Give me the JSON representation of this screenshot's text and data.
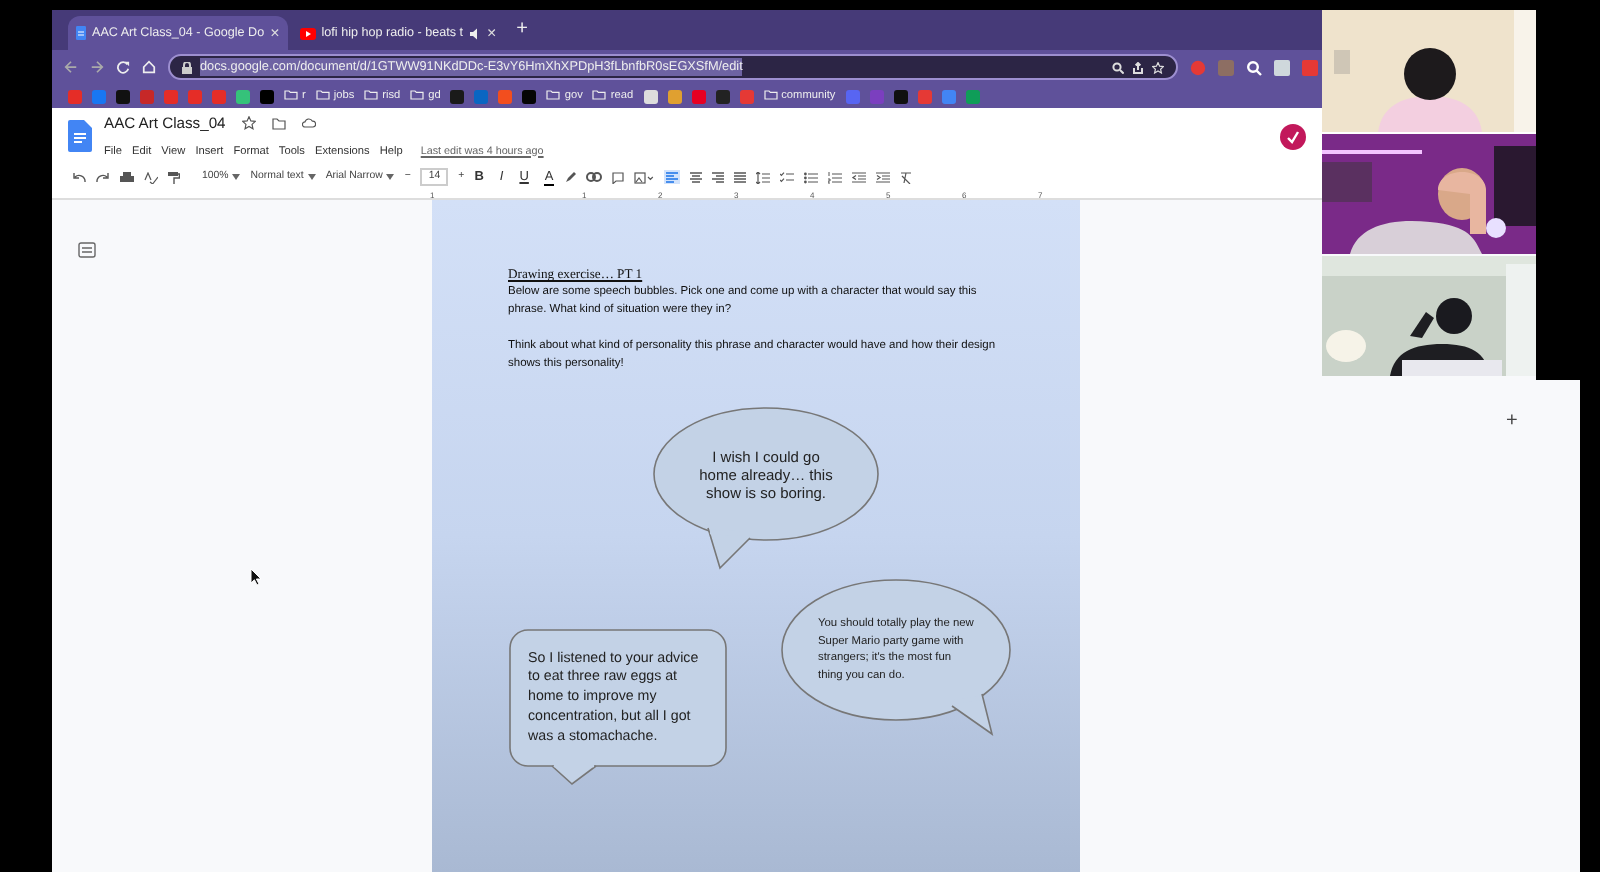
{
  "browser": {
    "tabs": [
      {
        "title": "AAC Art Class_04 - Google Do",
        "selected": true,
        "close": "×"
      },
      {
        "title": "lofi hip hop radio - beats t",
        "selected": false,
        "close": "×",
        "audio": true
      }
    ],
    "new_tab": "+",
    "url": "docs.google.com/document/d/1GTWW91NKdDDc-E3vY6HmXhXPDpH3fLbnfbR0sEGXSfM/edit",
    "bookmarks": [
      {
        "kind": "site",
        "color": "#e52d27"
      },
      {
        "kind": "site",
        "color": "#1877f2"
      },
      {
        "kind": "site",
        "color": "#111111"
      },
      {
        "kind": "site",
        "color": "#c62828"
      },
      {
        "kind": "site",
        "color": "#e52d27"
      },
      {
        "kind": "site",
        "color": "#e52d27"
      },
      {
        "kind": "site",
        "color": "#e52d27"
      },
      {
        "kind": "site",
        "color": "#35c27a"
      },
      {
        "kind": "site",
        "color": "#000000"
      },
      {
        "kind": "folder",
        "label": "r"
      },
      {
        "kind": "folder",
        "label": "jobs"
      },
      {
        "kind": "folder",
        "label": "risd"
      },
      {
        "kind": "folder",
        "label": "gd"
      },
      {
        "kind": "site",
        "color": "#1a1a1a"
      },
      {
        "kind": "site",
        "color": "#0a66c2"
      },
      {
        "kind": "site",
        "color": "#f24e1e"
      },
      {
        "kind": "site",
        "color": "#050505"
      },
      {
        "kind": "folder",
        "label": "gov"
      },
      {
        "kind": "folder",
        "label": "read"
      },
      {
        "kind": "site",
        "color": "#dddddd"
      },
      {
        "kind": "site",
        "color": "#e0a030"
      },
      {
        "kind": "site",
        "color": "#e60023"
      },
      {
        "kind": "site",
        "color": "#222222"
      },
      {
        "kind": "site",
        "color": "#e53935"
      },
      {
        "kind": "folder",
        "label": "community"
      },
      {
        "kind": "site",
        "color": "#5865f2"
      },
      {
        "kind": "site",
        "color": "#7b3fbf"
      },
      {
        "kind": "site",
        "color": "#101010"
      },
      {
        "kind": "site",
        "color": "#e53935"
      },
      {
        "kind": "site",
        "color": "#4285f4"
      },
      {
        "kind": "site",
        "color": "#0f9d58"
      }
    ]
  },
  "docs": {
    "title": "AAC Art Class_04",
    "menu": [
      "File",
      "Edit",
      "View",
      "Insert",
      "Format",
      "Tools",
      "Extensions",
      "Help"
    ],
    "last_edit": "Last edit was 4 hours ago",
    "toolbar": {
      "zoom": "100%",
      "style": "Normal text",
      "font": "Arial Narrow",
      "size_minus": "−",
      "font_size": "14",
      "size_plus": "+",
      "format": [
        "B",
        "I",
        "U",
        "A"
      ]
    },
    "ruler": [
      "1",
      "1",
      "2",
      "3",
      "4",
      "5",
      "6",
      "7"
    ],
    "heading": "Drawing exercise… PT 1",
    "paragraphs": [
      "Below are some speech bubbles. Pick one and come up with a character that would say this phrase. What kind of situation were they in?",
      "Think about what kind of personality this phrase and character would have and how their design shows this personality!"
    ],
    "bubbles": [
      {
        "kind": "oval_down",
        "text": "I wish I could go home already… this show is so boring."
      },
      {
        "kind": "oval_right",
        "text": "You should totally play the new Super Mario party game with strangers; it's the most fun thing you can do."
      },
      {
        "kind": "rounded",
        "text": "So I listened to your advice to eat three raw eggs at home to improve my concentration, but all I got was a stomachache."
      }
    ],
    "side_button": "+"
  }
}
